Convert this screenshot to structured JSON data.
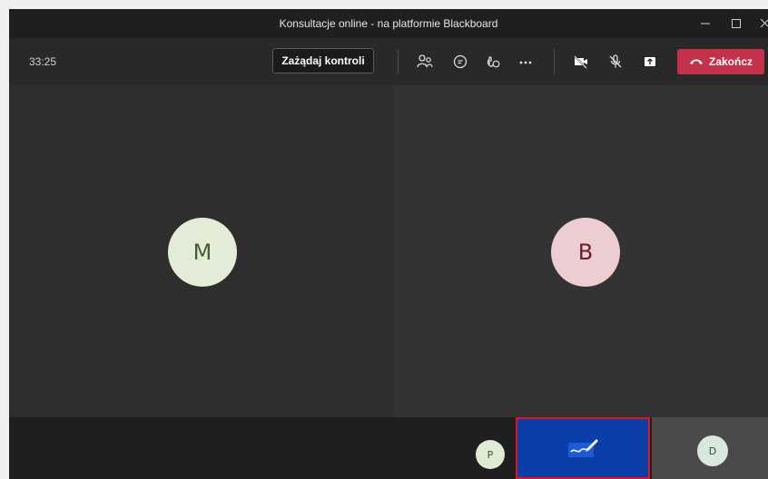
{
  "window": {
    "title": "Konsultacje online - na platformie Blackboard"
  },
  "toolbar": {
    "timer": "33:25",
    "request_control_label": "Zażądaj kontroli",
    "end_call_label": "Zakończ",
    "icons": [
      "people-icon",
      "chat-icon",
      "reactions-icon",
      "more-icon",
      "camera-off-icon",
      "mic-off-icon",
      "share-icon",
      "phone-hangup-icon"
    ]
  },
  "participants": {
    "main": [
      {
        "initial": "M",
        "bg": "#e3ecd6",
        "fg": "#4a5d2e"
      },
      {
        "initial": "B",
        "bg": "#ebcdd2",
        "fg": "#6b1f2a"
      }
    ],
    "small_p": {
      "initial": "P",
      "bg": "#e0ebd3",
      "fg": "#44572b"
    },
    "small_d": {
      "initial": "D",
      "bg": "#d9e8dc",
      "fg": "#2f4d35"
    }
  },
  "colors": {
    "end_call": "#c4314b",
    "whiteboard": "#0b3fa8",
    "highlight": "#e81123"
  }
}
